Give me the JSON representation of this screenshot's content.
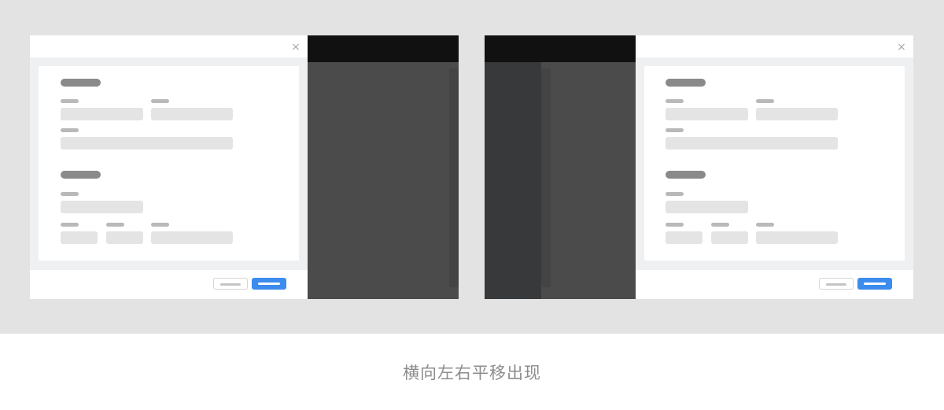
{
  "caption": "横向左右平移出现",
  "drawer": {
    "close_icon": "close-icon",
    "close_glyph": "×"
  },
  "colors": {
    "stage_background": "#e3e3e3",
    "overlay": "#4b4b4b",
    "overlay_top": "#111111",
    "nav_column": "#37393b",
    "primary_button": "#3b8ced",
    "caption_text": "#8c8c8c"
  }
}
